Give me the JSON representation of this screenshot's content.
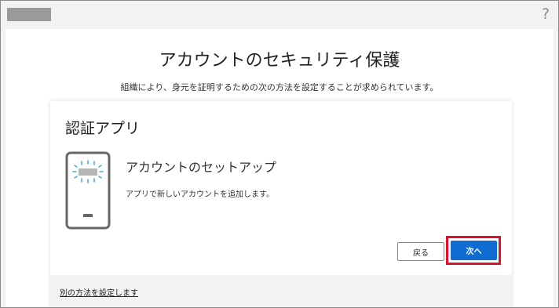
{
  "header": {
    "help_symbol": "?"
  },
  "page": {
    "title": "アカウントのセキュリティ保護",
    "subtitle": "組織により、身元を証明するための次の方法を設定することが求められています。"
  },
  "card": {
    "title": "認証アプリ",
    "icon": "phone-icon",
    "method_title": "アカウントのセットアップ",
    "method_description": "アプリで新しいアカウントを追加します。",
    "back_label": "戻る",
    "next_label": "次へ",
    "alt_method_link": "別の方法を設定します"
  },
  "colors": {
    "primary": "#0f6cd0",
    "highlight": "#e0102d",
    "phone_accent": "#4aa3df",
    "phone_body": "#666666"
  }
}
